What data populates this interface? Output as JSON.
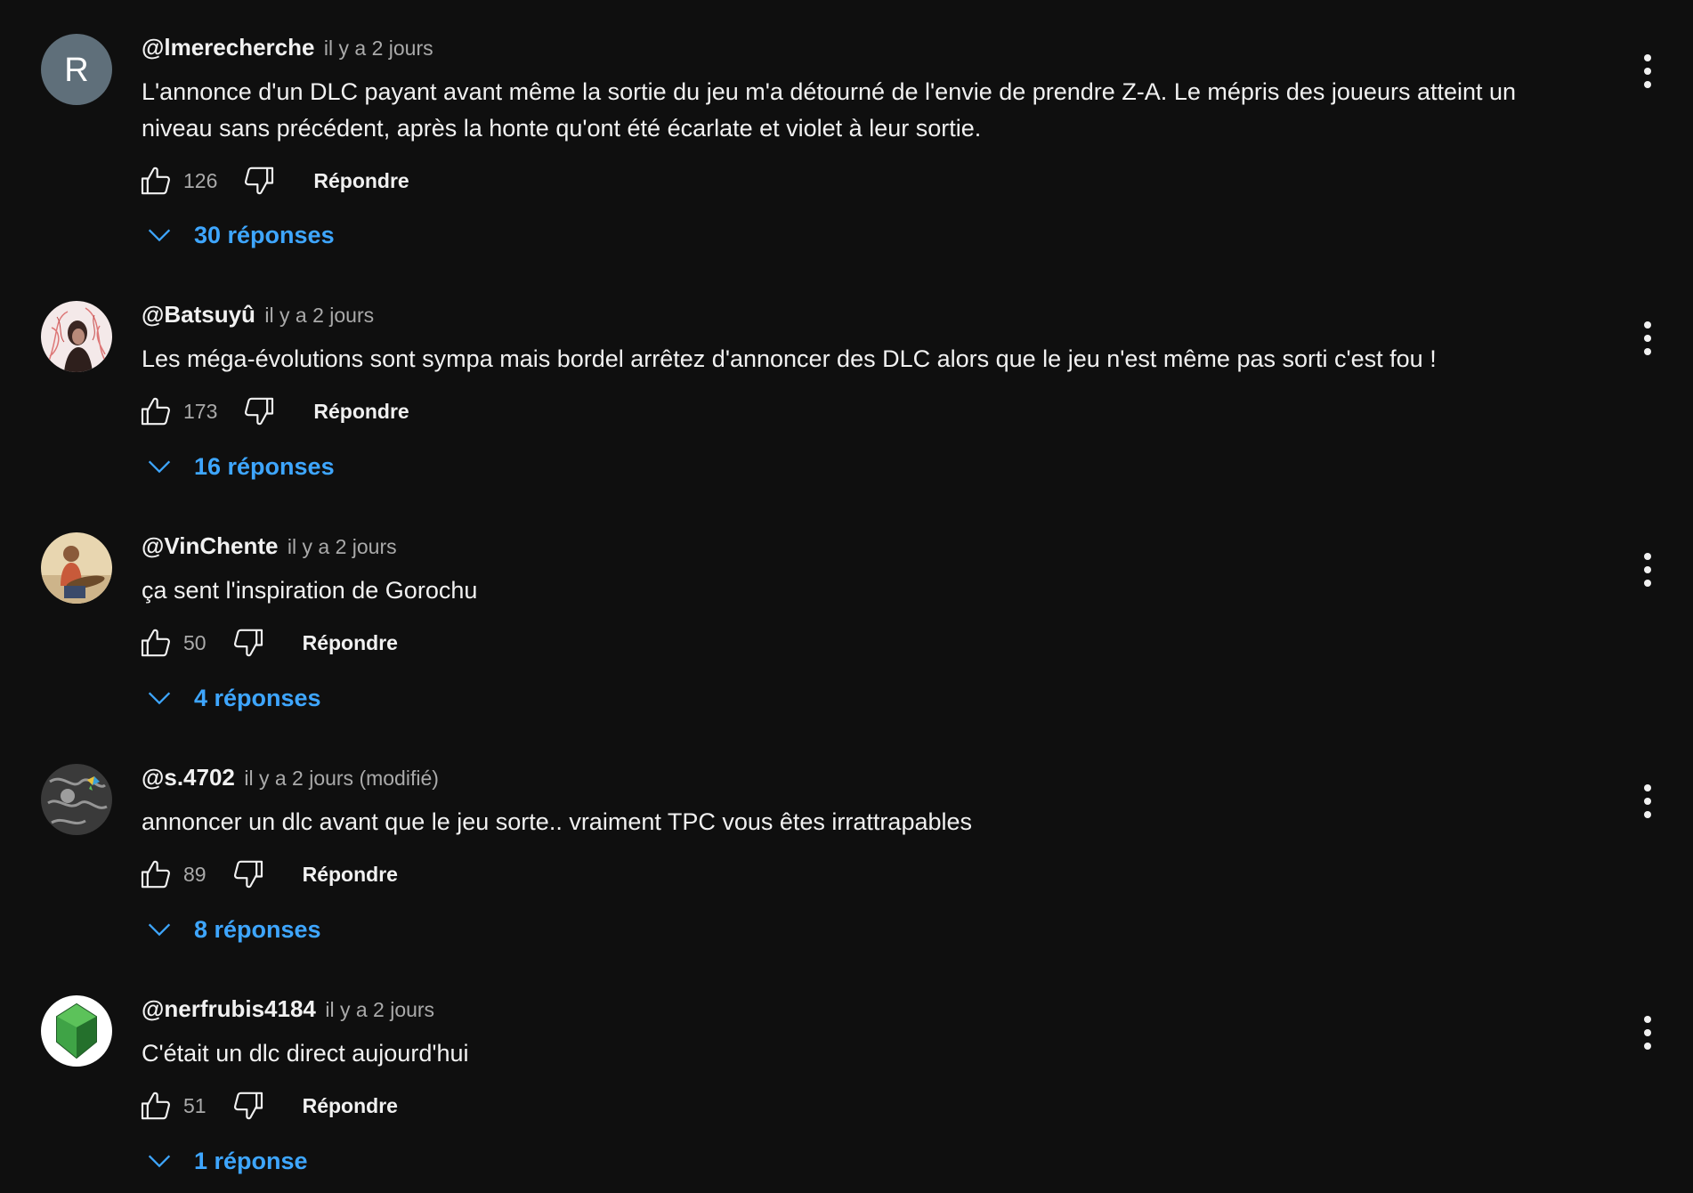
{
  "comments": [
    {
      "author": "@lmerecherche",
      "time": "il y a 2 jours",
      "text": "L'annonce d'un DLC payant avant même la sortie du jeu m'a détourné de l'envie de prendre Z-A. Le mépris des joueurs atteint un niveau sans précédent, après la honte qu'ont été écarlate et violet à leur sortie.",
      "likes": "126",
      "reply_label": "Répondre",
      "replies_label": "30 réponses",
      "avatar_letter": "R"
    },
    {
      "author": "@Batsuyû",
      "time": "il y a 2 jours",
      "text": "Les méga-évolutions sont sympa mais bordel arrêtez d'annoncer des DLC alors que le jeu n'est même pas sorti c'est fou !",
      "likes": "173",
      "reply_label": "Répondre",
      "replies_label": "16 réponses"
    },
    {
      "author": "@VinChente",
      "time": "il y a 2 jours",
      "text": "ça sent l'inspiration de Gorochu",
      "likes": "50",
      "reply_label": "Répondre",
      "replies_label": "4 réponses"
    },
    {
      "author": "@s.4702",
      "time": "il y a 2 jours (modifié)",
      "text": "annoncer un dlc avant que le jeu sorte.. vraiment TPC vous êtes irrattrapables",
      "likes": "89",
      "reply_label": "Répondre",
      "replies_label": "8 réponses"
    },
    {
      "author": "@nerfrubis4184",
      "time": "il y a 2 jours",
      "text": "C'était un dlc direct aujourd'hui",
      "likes": "51",
      "reply_label": "Répondre",
      "replies_label": "1 réponse"
    }
  ],
  "colors": {
    "background": "#0f0f0f",
    "text_primary": "#f1f1f1",
    "text_secondary": "#aaaaaa",
    "replies_link": "#3ea6ff",
    "avatar_letter_bg": "#5f6f7a"
  },
  "icons": {
    "like": "thumbs-up-icon",
    "dislike": "thumbs-down-icon",
    "replies": "chevron-down-icon",
    "menu": "more-vertical-icon"
  }
}
